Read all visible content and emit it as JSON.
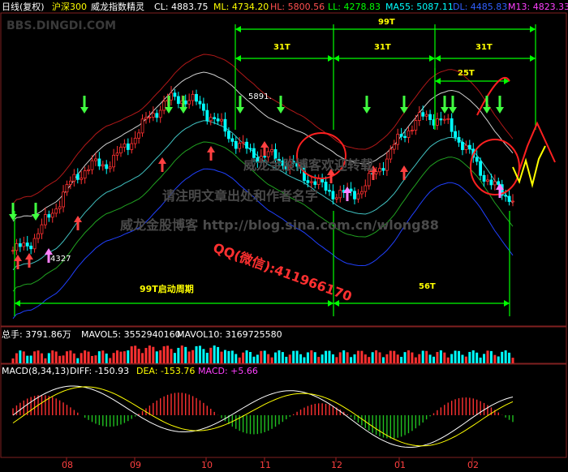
{
  "header": {
    "period": "日线(复权)",
    "symbol": "沪深300",
    "indicator": "威龙指数精灵",
    "cl": "CL: 4883.75",
    "ml": "ML: 4734.20",
    "hl": "HL: 5800.56",
    "ll": "LL: 4278.83",
    "ma55": "MA55: 5087.11",
    "dl": "DL: 4485.83",
    "m13": "M13: 4823.33"
  },
  "watermarks": {
    "site": "BBS.DINGDI.COM",
    "blog_name": "威龙金股博客",
    "welcome": "威龙金股博客欢迎转载",
    "notice": "请注明文章出处和作者名字",
    "url": "http://blog.sina.com.cn/wlong88",
    "contact": "QQ(微信):411966170"
  },
  "cycle_labels": {
    "total_top": "99T",
    "seg1": "31T",
    "seg2": "31T",
    "seg3": "31T",
    "sub": "25T",
    "start_cycle": "99T启动周期",
    "bottom_right": "56T"
  },
  "price_labels": {
    "high": "5891.",
    "low": "4327"
  },
  "volume": {
    "label": "总手: 3791.86万",
    "mavol5": "MAVOL5: 3552940160",
    "mavol10": "MAVOL10: 3169725580"
  },
  "macd": {
    "label": "MACD(8,34,13)",
    "diff": "DIFF: -150.93",
    "dea": "DEA: -153.76",
    "macd": "MACD: +5.66"
  },
  "colors": {
    "up": "#ff3030",
    "down": "#00ffff",
    "cycle_line": "#00ff00",
    "cycle_text": "#ffff00",
    "circle": "#ff2020",
    "background": "#000000"
  },
  "chart_data": {
    "type": "candlestick",
    "title": "沪深300 日线(复权)",
    "x_ticks": [
      "08",
      "09",
      "10",
      "11",
      "12",
      "01",
      "02"
    ],
    "approx_close_path": [
      {
        "month": "08",
        "value": 4327
      },
      {
        "month": "09",
        "value": 5200
      },
      {
        "month": "10",
        "value": 5891
      },
      {
        "month": "11",
        "value": 5300
      },
      {
        "month": "12",
        "value": 4900
      },
      {
        "month": "01",
        "value": 5700
      },
      {
        "month": "02",
        "value": 4883
      }
    ],
    "cycles": [
      {
        "label": "99T",
        "from": "10",
        "to": "02"
      },
      {
        "label": "31T",
        "from": "10",
        "to": "11"
      },
      {
        "label": "31T",
        "from": "12",
        "to": "01"
      },
      {
        "label": "31T",
        "from": "01",
        "to": "02"
      },
      {
        "label": "25T",
        "from": "01",
        "to": "02"
      },
      {
        "label": "99T启动周期",
        "from": "08",
        "to": "12"
      },
      {
        "label": "56T",
        "from": "12",
        "to": "02"
      }
    ]
  }
}
